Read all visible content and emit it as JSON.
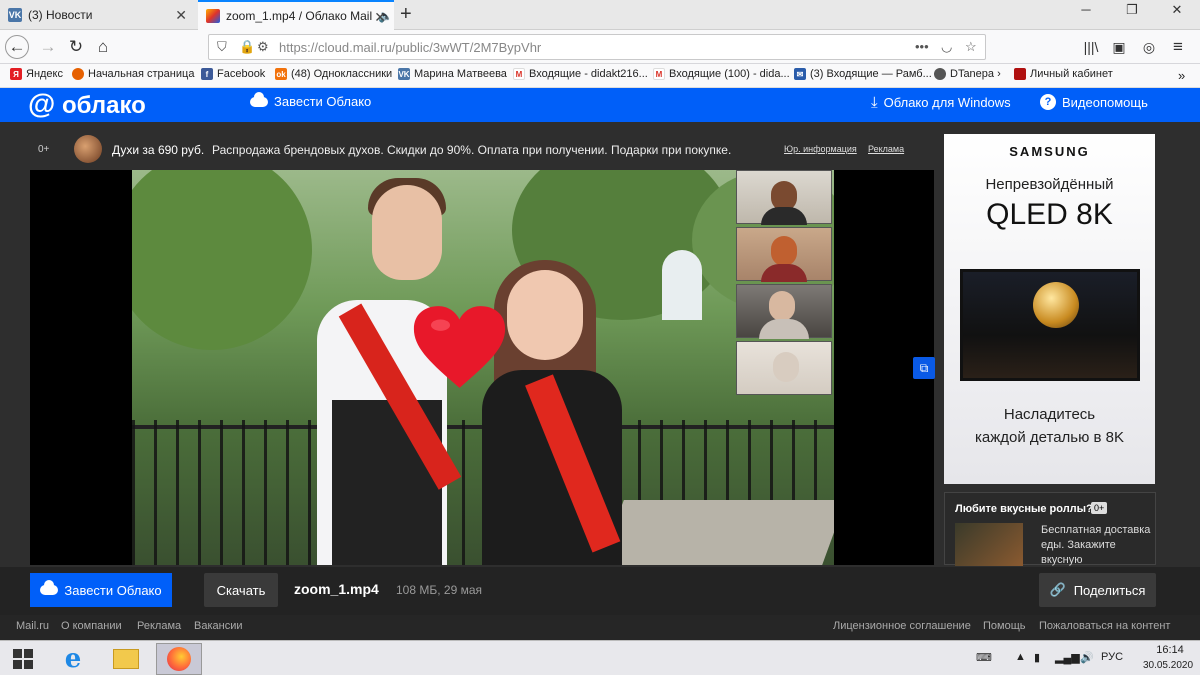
{
  "browser": {
    "tabs": [
      {
        "title": "(3) Новости",
        "favicon": "vk-icon"
      },
      {
        "title": "zoom_1.mp4 / Облако Mail",
        "favicon": "cloud-mail-icon"
      }
    ],
    "new_tab": "+",
    "url": "https://cloud.mail.ru/public/3wWT/2M7BypVhr",
    "url_host_bold": "mail.ru"
  },
  "bookmarks": [
    {
      "label": "Яндекс",
      "icon": "yandex-icon",
      "color": "#e31e24"
    },
    {
      "label": "Начальная страница",
      "icon": "firefox-icon",
      "color": "#e66000"
    },
    {
      "label": "Facebook",
      "icon": "facebook-icon",
      "color": "#3b5998"
    },
    {
      "label": "(48) Одноклассники",
      "icon": "ok-icon",
      "color": "#f2720c"
    },
    {
      "label": "Марина Матвеева",
      "icon": "vk-icon",
      "color": "#4a76a8"
    },
    {
      "label": "Входящие - didakt216...",
      "icon": "gmail-icon",
      "color": "#d93025"
    },
    {
      "label": "Входящие (100) - dida...",
      "icon": "gmail-icon",
      "color": "#d93025"
    },
    {
      "label": "(3) Входящие — Рамб...",
      "icon": "mail-icon",
      "color": "#2a5caa"
    },
    {
      "label": "DTanepa ›",
      "icon": "globe-icon",
      "color": "#555555"
    },
    {
      "label": "Личный кабинет",
      "icon": "cabinet-icon",
      "color": "#b01010"
    }
  ],
  "cloud_header": {
    "logo": "облако",
    "get_cloud": "Завести Облако",
    "windows": "Облако для Windows",
    "help": "Видеопомощь"
  },
  "ad_bar": {
    "age": "0+",
    "title": "Духи за 690 руб.",
    "text": "Распродажа брендовых духов. Скидки до 90%. Оплата при получении. Подарки при покупке.",
    "legal": "Юр. информация",
    "ad": "Реклама"
  },
  "right_ad": {
    "brand": "SAMSUNG",
    "line1": "Непревзойдённый",
    "line2": "QLED 8K",
    "line3": "Насладитесь",
    "line4": "каждой деталью в 8K"
  },
  "right_ad2": {
    "title": "Любите вкусные роллы?",
    "age": "0+",
    "text": "Бесплатная доставка еды. Закажите вкусную"
  },
  "action_bar": {
    "get_cloud": "Завести Облако",
    "download": "Скачать",
    "filename": "zoom_1.mp4",
    "meta": "108 МБ, 29 мая",
    "share": "Поделиться"
  },
  "footer": {
    "links": [
      "Mail.ru",
      "О компании",
      "Реклама",
      "Вакансии"
    ],
    "right_links": [
      "Лицензионное соглашение",
      "Помощь",
      "Пожаловаться на контент"
    ]
  },
  "taskbar": {
    "lang": "РУС",
    "time": "16:14",
    "date": "30.05.2020"
  },
  "colors": {
    "accent": "#005ff9",
    "tab_highlight": "#0a84ff"
  }
}
